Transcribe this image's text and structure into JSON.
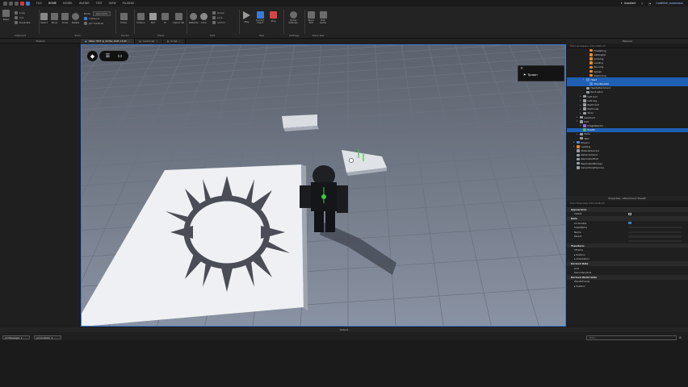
{
  "menubar": {
    "items": [
      "FILE",
      "HOME",
      "MODEL",
      "AVATAR",
      "TEST",
      "VIEW",
      "PLUGINS"
    ],
    "active": "HOME",
    "assistant_label": "Assistant",
    "user_label": "CoolKitch_xxxxxxxxx"
  },
  "ribbon": {
    "clipboard": {
      "label": "Clipboard",
      "paste": "Paste",
      "copy": "Copy",
      "cut": "Cut",
      "duplicate": "Duplicate"
    },
    "tools": {
      "label": "Tools",
      "select": "Select",
      "move": "Move",
      "scale": "Scale",
      "rotate": "Rotate",
      "mode": "Mode:",
      "mode_value": "Geometric",
      "collisions": "Collisions",
      "join_surfaces": "Join Surfaces"
    },
    "terrain": {
      "label": "Terrain",
      "editor": "Editor"
    },
    "insert": {
      "label": "Insert",
      "toolbox": "Toolbox",
      "part": "Part",
      "ui": "UI",
      "import3d": "Import 3D"
    },
    "file": {
      "label": "File"
    },
    "edit": {
      "label": "Edit",
      "material": "Material",
      "color": "Color",
      "group": "Group",
      "lock": "Lock",
      "anchor": "Anchor"
    },
    "test": {
      "label": "Test",
      "play": "Play",
      "current_client": "Current Client",
      "stop": "Stop"
    },
    "settings": {
      "label": "Settings",
      "game_settings": "Game Settings"
    },
    "team_test": {
      "label": "Team Test",
      "team_test": "Team Test",
      "exit_game": "Exit Game"
    }
  },
  "toolbox_title": "Toolbox",
  "tabs": [
    {
      "label": "DRAG TEST @ 29 Mar 2025 13:08",
      "active": true
    },
    {
      "label": "CoreScript",
      "active": false
    },
    {
      "label": "Script",
      "active": false
    }
  ],
  "viewport": {
    "tycoon_label": "Tycoon",
    "colors": {
      "sky": "#5f6470",
      "floor": "#7f8796",
      "grid": "#6d7482",
      "selection": "#3d7bd1"
    }
  },
  "explorer": {
    "title": "Explorer",
    "filter_placeholder": "Filter workspace (Ctrl+Shift+X)",
    "rows": [
      {
        "label": "Freefalling",
        "indent": 5,
        "icon": "orange",
        "arrow": ""
      },
      {
        "label": "GettingUp",
        "indent": 5,
        "icon": "orange",
        "arrow": ""
      },
      {
        "label": "Jumping",
        "indent": 5,
        "icon": "orange",
        "arrow": ""
      },
      {
        "label": "Landing",
        "indent": 5,
        "icon": "orange",
        "arrow": ""
      },
      {
        "label": "Running",
        "indent": 5,
        "icon": "orange",
        "arrow": ""
      },
      {
        "label": "Splash",
        "indent": 5,
        "icon": "orange",
        "arrow": ""
      },
      {
        "label": "Swimming",
        "indent": 5,
        "icon": "orange",
        "arrow": ""
      },
      {
        "label": "Head",
        "indent": 4,
        "icon": "blue",
        "arrow": "▾",
        "selected": true
      },
      {
        "label": "ClientLookAt",
        "indent": 5,
        "icon": "blue",
        "arrow": "",
        "selected": true
      },
      {
        "label": "HeadAttachment",
        "indent": 4,
        "icon": "gray",
        "arrow": ""
      },
      {
        "label": "Root.sstck",
        "indent": 4,
        "icon": "gray",
        "arrow": ""
      },
      {
        "label": "Left Arm",
        "indent": 3,
        "icon": "gray",
        "arrow": "▸"
      },
      {
        "label": "Left Leg",
        "indent": 3,
        "icon": "gray",
        "arrow": "▸"
      },
      {
        "label": "Right Arm",
        "indent": 3,
        "icon": "gray",
        "arrow": "▸"
      },
      {
        "label": "Right Leg",
        "indent": 3,
        "icon": "gray",
        "arrow": "▸"
      },
      {
        "label": "Torso",
        "indent": 3,
        "icon": "gray",
        "arrow": "▸"
      },
      {
        "label": "Seaobsrd",
        "indent": 2,
        "icon": "gray",
        "arrow": "▸"
      },
      {
        "label": "Part",
        "indent": 2,
        "icon": "gray",
        "arrow": "▾"
      },
      {
        "label": "DragDetector",
        "indent": 3,
        "icon": "purple",
        "arrow": "▸"
      },
      {
        "label": "PosAtt",
        "indent": 3,
        "icon": "green",
        "arrow": "",
        "selected": true
      },
      {
        "label": "Parts",
        "indent": 2,
        "icon": "gray",
        "arrow": "▸"
      },
      {
        "label": "Wall",
        "indent": 2,
        "icon": "gray",
        "arrow": ""
      },
      {
        "label": "Players",
        "indent": 1,
        "icon": "blue",
        "arrow": "▸"
      },
      {
        "label": "Lighting",
        "indent": 1,
        "icon": "orange",
        "arrow": "▸"
      },
      {
        "label": "MaterialService",
        "indent": 1,
        "icon": "gray",
        "arrow": ""
      },
      {
        "label": "NetworkClient",
        "indent": 1,
        "icon": "gray",
        "arrow": ""
      },
      {
        "label": "ReplicatedFirst",
        "indent": 1,
        "icon": "gray",
        "arrow": ""
      },
      {
        "label": "ReplicatedStorage",
        "indent": 1,
        "icon": "gray",
        "arrow": ""
      },
      {
        "label": "ServerScriptService",
        "indent": 1,
        "icon": "gray",
        "arrow": ""
      }
    ]
  },
  "properties": {
    "title": "Properties - Attachment \"PosAtt\"",
    "filter_placeholder": "Filter Properties (Ctrl+Shift+P)",
    "rows": [
      {
        "type": "cat",
        "label": "Appearance"
      },
      {
        "type": "prop",
        "label": "Visible",
        "kind": "box"
      },
      {
        "type": "cat",
        "label": "Data"
      },
      {
        "type": "prop",
        "label": "Archivable",
        "kind": "check"
      },
      {
        "type": "prop",
        "label": "ClassName",
        "kind": "bar"
      },
      {
        "type": "prop",
        "label": "Name",
        "kind": "bar"
      },
      {
        "type": "prop",
        "label": "Parent",
        "kind": "bar"
      },
      {
        "type": "prop",
        "label": "",
        "kind": "bar"
      },
      {
        "type": "cat",
        "label": "Transform"
      },
      {
        "type": "prop",
        "label": "CFrame",
        "kind": ""
      },
      {
        "type": "prop",
        "label": "▸ Position",
        "kind": ""
      },
      {
        "type": "prop",
        "label": "▸ Orientation",
        "kind": ""
      },
      {
        "type": "cat",
        "label": "Derived Data"
      },
      {
        "type": "prop",
        "label": "Axis",
        "kind": ""
      },
      {
        "type": "prop",
        "label": "SecondaryAxis",
        "kind": ""
      },
      {
        "type": "cat",
        "label": "Derived World Data"
      },
      {
        "type": "prop",
        "label": "WorldCFrame",
        "kind": ""
      },
      {
        "type": "prop",
        "label": "▸ Position",
        "kind": ""
      }
    ]
  },
  "output": {
    "title": "Output",
    "messages_dropdown": "All Messages",
    "contexts_dropdown": "All Contexts",
    "filter_placeholder": "Filter..."
  }
}
